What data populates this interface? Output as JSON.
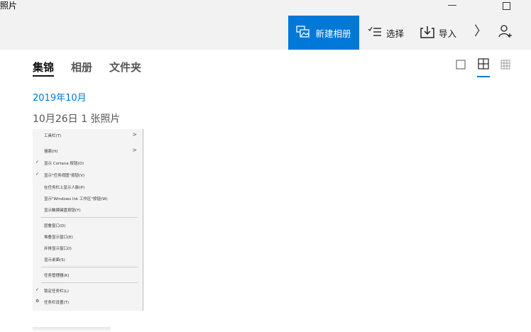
{
  "window": {
    "title": "照片",
    "minimize_glyph": "—"
  },
  "toolbar": {
    "new_album_label": "新建相册",
    "select_label": "选择",
    "import_label": "导入",
    "next_glyph": "〉"
  },
  "tabs": [
    {
      "label": "集锦",
      "active": true
    },
    {
      "label": "相册",
      "active": false
    },
    {
      "label": "文件夹",
      "active": false
    }
  ],
  "view_options": [
    "large-tiles",
    "medium-tiles",
    "small-tiles"
  ],
  "selected_view": "medium-tiles",
  "content": {
    "month_heading": "2019年10月",
    "date_line": "10月26日   1 张照片"
  },
  "thumbnail_menu": {
    "items": [
      {
        "label": "工具栏(T)",
        "submenu": true
      },
      {
        "label": "搜索(H)",
        "submenu": true
      },
      {
        "label": "显示 Cortana 按钮(O)",
        "checked": true
      },
      {
        "label": "显示\"任务视图\"按钮(V)",
        "checked": true
      },
      {
        "label": "在任务栏上显示人脉(P)"
      },
      {
        "label": "显示\"Windows Ink 工作区\"按钮(W)"
      },
      {
        "label": "显示触摸键盘按钮(Y)"
      },
      {
        "label": "层叠窗口(D)"
      },
      {
        "label": "堆叠显示窗口(E)"
      },
      {
        "label": "并排显示窗口(I)"
      },
      {
        "label": "显示桌面(S)"
      },
      {
        "label": "任务管理器(K)"
      },
      {
        "label": "锁定任务栏(L)",
        "checked": true
      },
      {
        "label": "任务栏设置(T)",
        "gear": true
      }
    ],
    "submenu_glyph": ">",
    "check_glyph": "✓",
    "gear_glyph": "⚙"
  },
  "colors": {
    "accent": "#0078d7",
    "titlebar_bg": "#f2f2f2"
  }
}
